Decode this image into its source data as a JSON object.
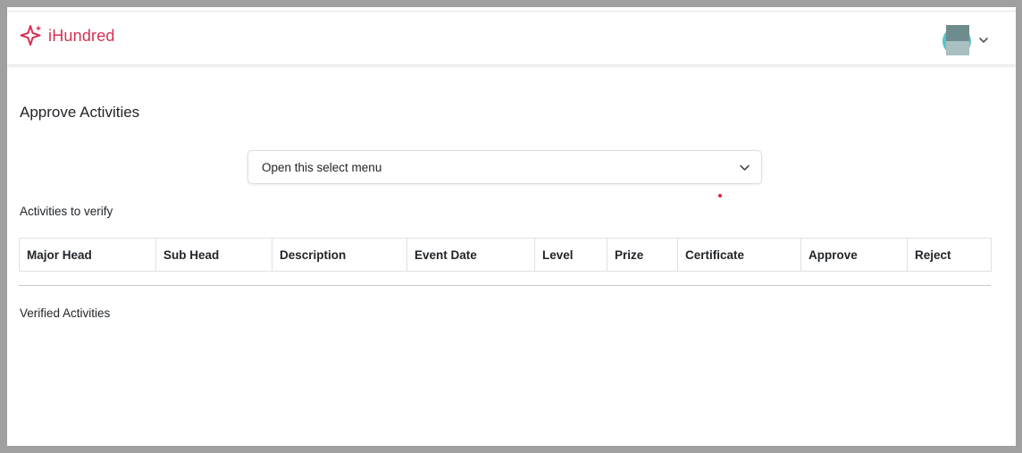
{
  "brand": {
    "name": "iHundred",
    "icon": "sparkle-icon",
    "color": "#d63151"
  },
  "user_menu": {
    "avatar": "avatar",
    "caret_icon": "chevron-down-icon"
  },
  "page": {
    "title": "Approve Activities"
  },
  "select": {
    "value": "Open this select menu",
    "caret_icon": "chevron-down-icon"
  },
  "sections": {
    "to_verify": "Activities to verify",
    "verified": "Verified Activities"
  },
  "table": {
    "columns": [
      "Major Head",
      "Sub Head",
      "Description",
      "Event Date",
      "Level",
      "Prize",
      "Certificate",
      "Approve",
      "Reject"
    ],
    "rows": []
  }
}
